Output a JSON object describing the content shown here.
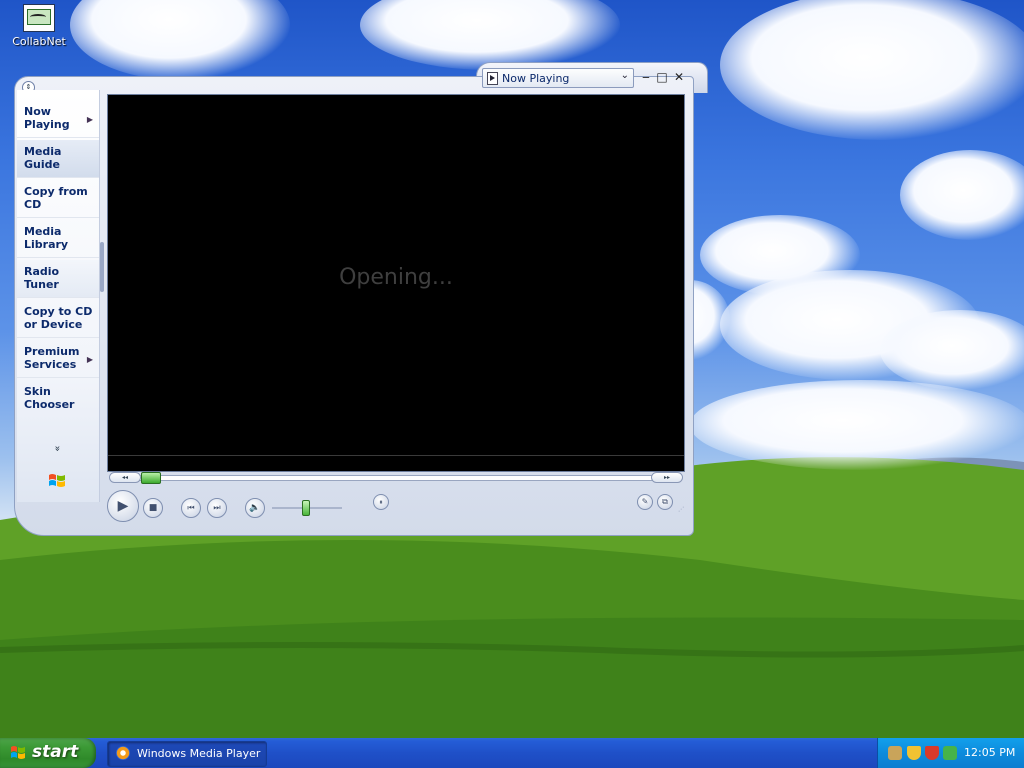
{
  "desktop": {
    "icons": [
      {
        "label": "CollabNet"
      }
    ]
  },
  "wmp": {
    "taskpane": {
      "items": [
        {
          "label": "Now Playing",
          "has_arrow": true
        },
        {
          "label": "Media Guide",
          "has_arrow": false
        },
        {
          "label": "Copy from CD",
          "has_arrow": false
        },
        {
          "label": "Media Library",
          "has_arrow": false
        },
        {
          "label": "Radio Tuner",
          "has_arrow": false
        },
        {
          "label": "Copy to CD or Device",
          "has_arrow": false
        },
        {
          "label": "Premium Services",
          "has_arrow": true
        },
        {
          "label": "Skin Chooser",
          "has_arrow": false
        }
      ],
      "more": "»"
    },
    "title_select": {
      "value": "Now Playing"
    },
    "video": {
      "status": "Opening..."
    },
    "window_buttons": {
      "minimize": "‒",
      "maximize": "□",
      "close": "✕"
    },
    "controls": {
      "play": "▶",
      "stop": "■",
      "prev": "⏮",
      "next": "⏭",
      "mute": "🔈",
      "shuffle": "⏸",
      "eq": "✎",
      "compact": "⧉",
      "seek_rew": "◂◂",
      "seek_ffw": "▸▸"
    }
  },
  "taskbar": {
    "start_label": "start",
    "buttons": [
      {
        "label": "Windows Media Player"
      }
    ],
    "clock": "12:05 PM"
  },
  "colors": {
    "taskbar_blue": "#245dd7",
    "start_green": "#3c9a36",
    "tray_blue": "#0d8bdc",
    "taskpane_text": "#0c2a6b"
  }
}
